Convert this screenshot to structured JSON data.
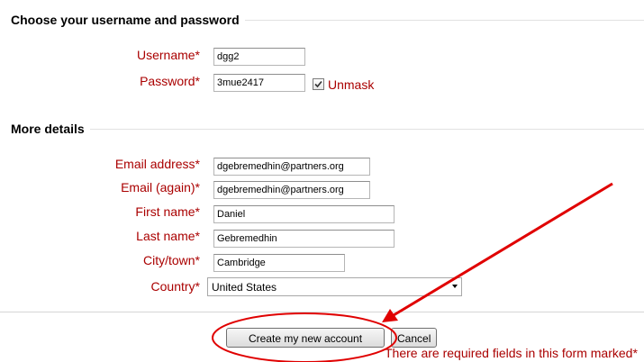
{
  "sections": {
    "account": {
      "title": "Choose your username and password"
    },
    "details": {
      "title": "More details"
    }
  },
  "fields": {
    "username": {
      "label": "Username*",
      "value": "dgg2"
    },
    "password": {
      "label": "Password*",
      "value": "3mue2417"
    },
    "unmask": {
      "label": "Unmask",
      "checked": true
    },
    "email": {
      "label": "Email address*",
      "value": "dgebremedhin@partners.org"
    },
    "email_again": {
      "label": "Email (again)*",
      "value": "dgebremedhin@partners.org"
    },
    "first_name": {
      "label": "First name*",
      "value": "Daniel"
    },
    "last_name": {
      "label": "Last name*",
      "value": "Gebremedhin"
    },
    "city": {
      "label": "City/town*",
      "value": "Cambridge"
    },
    "country": {
      "label": "Country*",
      "value": "United States"
    }
  },
  "buttons": {
    "create": "Create my new account",
    "cancel": "Cancel"
  },
  "required_note": "There are required fields in this form marked*",
  "colors": {
    "label": "#aa0000",
    "annotation": "#e00000"
  }
}
